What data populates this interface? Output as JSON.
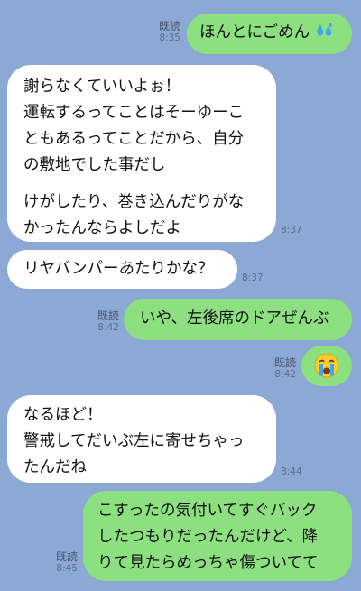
{
  "messages": [
    {
      "side": "out",
      "text": "ほんとにごめん",
      "emoji": "sweat-droplets-icon",
      "read": "既読",
      "time": "8:35"
    },
    {
      "side": "in",
      "lines": [
        "謝らなくていいよぉ！",
        "運転するってことはそーゆーこ",
        "ともあるってことだから、自分",
        "の敷地でした事だし"
      ],
      "lines2": [
        "けがしたり、巻き込んだりがな",
        "かったんならよしだよ"
      ],
      "time": "8:37"
    },
    {
      "side": "in",
      "text": "リヤバンパーあたりかな？",
      "time": "8:37"
    },
    {
      "side": "out",
      "text": "いや、左後席のドアぜんぶ",
      "read": "既読",
      "time": "8:42"
    },
    {
      "side": "out",
      "emoji": "crying-face-icon",
      "read": "既読",
      "time": "8:42"
    },
    {
      "side": "in",
      "lines": [
        "なるほど！",
        "警戒してだいぶ左に寄せちゃっ",
        "たんだね"
      ],
      "time": "8:44"
    },
    {
      "side": "out",
      "lines": [
        "こすったの気付いてすぐバック",
        "したつもりだったんだけど、降",
        "りて見たらめっちゃ傷ついてて"
      ],
      "read": "既読",
      "time": "8:45"
    }
  ]
}
